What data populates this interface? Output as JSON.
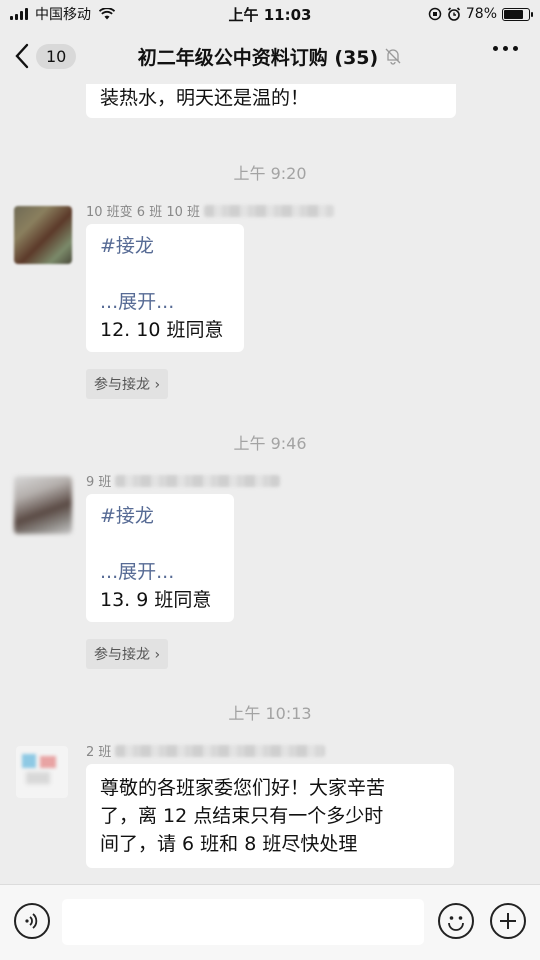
{
  "status_bar": {
    "carrier": "中国移动",
    "time": "上午 11:03",
    "battery_percent": "78%",
    "battery_level": 0.78
  },
  "nav": {
    "unread_count": "10",
    "title": "初二年级公中资料订购 (35)"
  },
  "messages": {
    "prev_tail": "装热水，明天还是温的！",
    "time_1": "上午 9:20",
    "msg1": {
      "sender_visible": "10 班变 6 班 10 班",
      "tag": "#接龙",
      "expand": "...展开...",
      "entry": "12. 10 班同意",
      "join_label": "参与接龙"
    },
    "time_2": "上午 9:46",
    "msg2": {
      "sender_visible": "9 班",
      "tag": "#接龙",
      "expand": "...展开...",
      "entry": "13. 9 班同意",
      "join_label": "参与接龙"
    },
    "time_3": "上午 10:13",
    "msg3": {
      "sender_visible": "2 班",
      "line1": "尊敬的各班家委您们好！大家辛苦",
      "line2": "了，离 12 点结束只有一个多少时",
      "line3": "间了，请 6 班和 8 班尽快处理"
    }
  },
  "input_bar": {
    "placeholder": ""
  },
  "icons": {
    "back": "chevron-left-icon",
    "mute": "bell-off-icon",
    "more": "more-dots-icon",
    "voice": "voice-icon",
    "emoji": "emoji-icon",
    "plus": "plus-icon"
  },
  "colors": {
    "background": "#ededed",
    "link": "#576b95",
    "timestamp": "#a3a3a3"
  }
}
